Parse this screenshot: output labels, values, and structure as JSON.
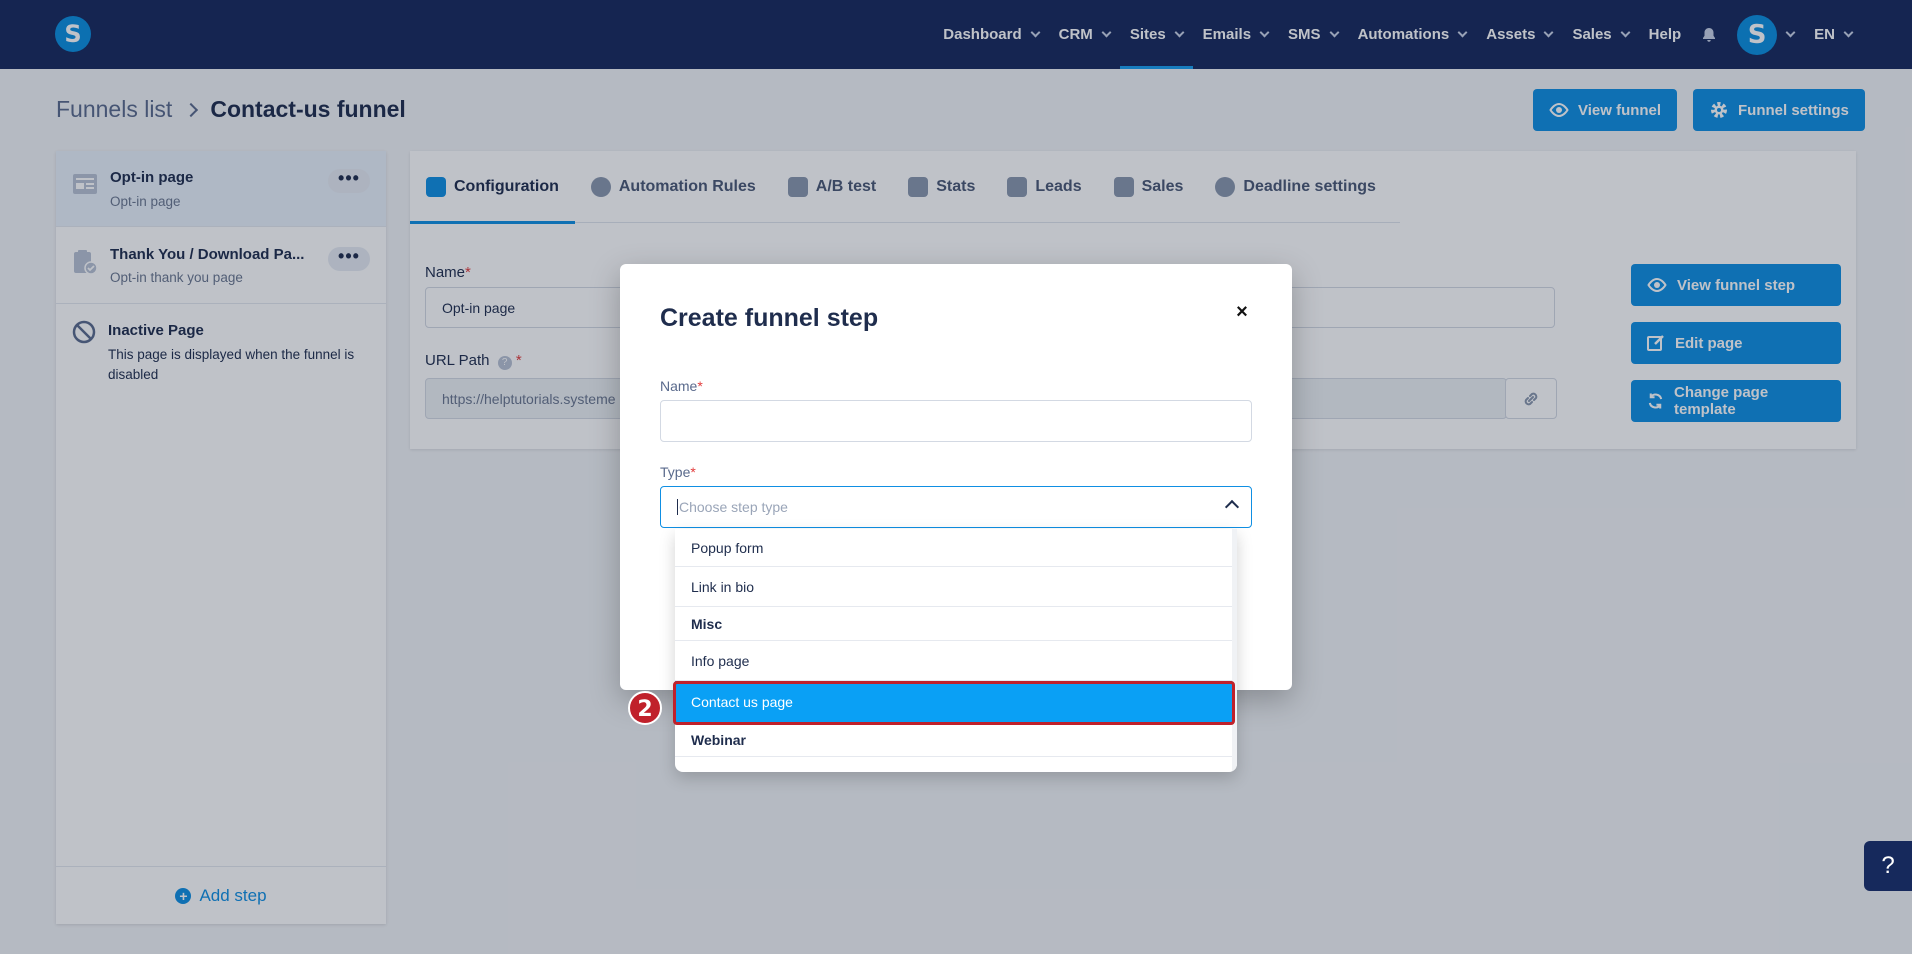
{
  "nav": {
    "logo": "S",
    "items": [
      {
        "label": "Dashboard"
      },
      {
        "label": "CRM"
      },
      {
        "label": "Sites"
      },
      {
        "label": "Emails"
      },
      {
        "label": "SMS"
      },
      {
        "label": "Automations"
      },
      {
        "label": "Assets"
      },
      {
        "label": "Sales"
      }
    ],
    "help": "Help",
    "avatar": "S",
    "language": "EN"
  },
  "breadcrumb": {
    "parent": "Funnels list",
    "current": "Contact-us funnel"
  },
  "header_buttons": {
    "view_funnel": "View funnel",
    "funnel_settings": "Funnel settings"
  },
  "sidebar": {
    "items": [
      {
        "title": "Opt-in page",
        "subtitle": "Opt-in page"
      },
      {
        "title": "Thank You / Download Pa...",
        "subtitle": "Opt-in thank you page"
      },
      {
        "title": "Inactive Page",
        "subtitle": "This page is displayed when the funnel is disabled"
      }
    ],
    "more": "•••",
    "add_step": "Add step"
  },
  "tabs": [
    {
      "label": "Configuration"
    },
    {
      "label": "Automation Rules"
    },
    {
      "label": "A/B test"
    },
    {
      "label": "Stats"
    },
    {
      "label": "Leads"
    },
    {
      "label": "Sales"
    },
    {
      "label": "Deadline settings"
    }
  ],
  "form": {
    "name_label": "Name",
    "name_value": "Opt-in page",
    "url_label": "URL Path",
    "url_value": "https://helptutorials.systeme"
  },
  "side_buttons": {
    "view_step": "View funnel step",
    "edit_page": "Edit page",
    "change_template": "Change page template"
  },
  "modal": {
    "title": "Create funnel step",
    "close": "×",
    "name_label": "Name",
    "type_label": "Type",
    "type_placeholder": "Choose step type"
  },
  "dropdown": {
    "items": [
      {
        "label": "Popup form",
        "kind": "option"
      },
      {
        "label": "Link in bio",
        "kind": "option"
      },
      {
        "label": "Misc",
        "kind": "group"
      },
      {
        "label": "Info page",
        "kind": "option"
      },
      {
        "label": "Contact us page",
        "kind": "option",
        "highlighted": true
      },
      {
        "label": "Webinar",
        "kind": "group"
      }
    ]
  },
  "annotation": {
    "step_number": "2"
  },
  "help_button": "?",
  "colors": {
    "nav_bg": "#16295c",
    "primary": "#0f8fe3",
    "highlight_option": "#0aa0f5",
    "annotation_red": "#c0212b"
  }
}
